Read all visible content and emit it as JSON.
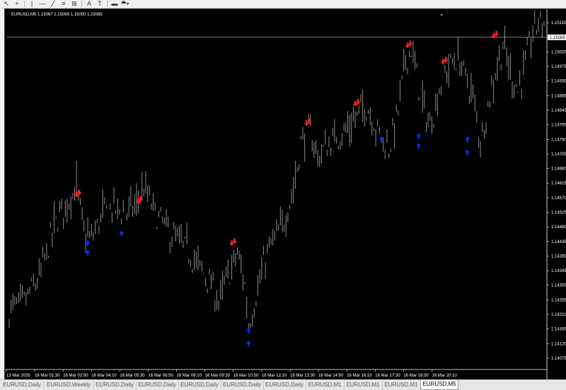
{
  "toolbar": {
    "tools": [
      {
        "name": "cursor-icon",
        "glyph": "↖"
      },
      {
        "name": "crosshair-icon",
        "glyph": "+"
      },
      {
        "name": "vertical-line-icon",
        "glyph": "|"
      },
      {
        "name": "horizontal-line-icon",
        "glyph": "—"
      },
      {
        "name": "trendline-icon",
        "glyph": "╱"
      },
      {
        "name": "channel-icon",
        "glyph": "≡"
      },
      {
        "name": "fibonacci-icon",
        "glyph": "⊞"
      },
      {
        "name": "text-icon",
        "glyph": "A"
      },
      {
        "name": "text-label-icon",
        "glyph": "T"
      },
      {
        "name": "rectangle-icon",
        "glyph": "▬"
      },
      {
        "name": "shapes-menu-icon",
        "glyph": "⯊▾"
      }
    ]
  },
  "chart": {
    "header": "EURUSD,M5  1.15067 1.15069 1.15050 1.15065",
    "current_price_label": "1.15065",
    "colors": {
      "background": "#000000",
      "candle": "#8c8c8c",
      "sell_arrow": "#ff1e1e",
      "buy_arrow": "#1428ff",
      "axis_text": "#ffffff"
    }
  },
  "chart_data": {
    "type": "bar",
    "symbol": "EURUSD",
    "timeframe": "M5",
    "y_ticks": [
      "1.15110",
      "1.15065",
      "1.15020",
      "1.14975",
      "1.14930",
      "1.14885",
      "1.14840",
      "1.14795",
      "1.14750",
      "1.14705",
      "1.14660",
      "1.14615",
      "1.14570",
      "1.14525",
      "1.14480",
      "1.14435",
      "1.14390",
      "1.14345",
      "1.14300",
      "1.14255",
      "1.14210",
      "1.14165",
      "1.14120",
      "1.14075"
    ],
    "ylim": [
      1.1404,
      1.1513
    ],
    "x_ticks": [
      "13 Mar 2026",
      "16 Mar 01:30",
      "16 Mar 02:50",
      "16 Mar 04:10",
      "16 Mar 05:30",
      "16 Mar 06:50",
      "16 Mar 08:10",
      "16 Mar 09:30",
      "16 Mar 10:50",
      "16 Mar 12:10",
      "16 Mar 13:30",
      "16 Mar 14:50",
      "16 Mar 16:10",
      "16 Mar 17:30",
      "16 Mar 18:50",
      "16 Mar 20:10"
    ],
    "price_path": [
      [
        0,
        1.1422
      ],
      [
        8,
        1.1425
      ],
      [
        16,
        1.1432
      ],
      [
        24,
        1.1448
      ],
      [
        30,
        1.1455
      ],
      [
        36,
        1.146
      ],
      [
        40,
        1.1446
      ],
      [
        44,
        1.1444
      ],
      [
        50,
        1.1452
      ],
      [
        56,
        1.1454
      ],
      [
        62,
        1.1452
      ],
      [
        68,
        1.1455
      ],
      [
        72,
        1.146
      ],
      [
        78,
        1.1452
      ],
      [
        86,
        1.1446
      ],
      [
        96,
        1.144
      ],
      [
        106,
        1.1432
      ],
      [
        112,
        1.1425
      ],
      [
        118,
        1.1434
      ],
      [
        122,
        1.144
      ],
      [
        126,
        1.143
      ],
      [
        128,
        1.1418
      ],
      [
        132,
        1.1427
      ],
      [
        138,
        1.144
      ],
      [
        146,
        1.1448
      ],
      [
        152,
        1.146
      ],
      [
        156,
        1.1474
      ],
      [
        160,
        1.1478
      ],
      [
        165,
        1.147
      ],
      [
        172,
        1.1474
      ],
      [
        180,
        1.1478
      ],
      [
        186,
        1.1482
      ],
      [
        190,
        1.1486
      ],
      [
        194,
        1.1482
      ],
      [
        198,
        1.1476
      ],
      [
        203,
        1.1472
      ],
      [
        208,
        1.1484
      ],
      [
        212,
        1.15
      ],
      [
        215,
        1.1503
      ],
      [
        218,
        1.1494
      ],
      [
        222,
        1.1484
      ],
      [
        225,
        1.1479
      ],
      [
        228,
        1.1486
      ],
      [
        232,
        1.1495
      ],
      [
        236,
        1.1498
      ],
      [
        240,
        1.15
      ],
      [
        244,
        1.1494
      ],
      [
        248,
        1.1488
      ],
      [
        252,
        1.1474
      ],
      [
        256,
        1.1486
      ],
      [
        260,
        1.1496
      ],
      [
        264,
        1.1504
      ],
      [
        268,
        1.1496
      ],
      [
        272,
        1.149
      ],
      [
        276,
        1.1498
      ],
      [
        280,
        1.1508
      ],
      [
        283,
        1.1511
      ]
    ],
    "sell_arrows": [
      [
        36,
        1.1458
      ],
      [
        69,
        1.1456
      ],
      [
        119,
        1.1443
      ],
      [
        159,
        1.148
      ],
      [
        185,
        1.1486
      ],
      [
        213,
        1.1504
      ],
      [
        232,
        1.1499
      ],
      [
        259,
        1.1507
      ]
    ],
    "buy_arrows": [
      [
        42,
        1.1443
      ],
      [
        42,
        1.144
      ],
      [
        60,
        1.1446
      ],
      [
        128,
        1.1416
      ],
      [
        128,
        1.1412
      ],
      [
        199,
        1.1475
      ],
      [
        219,
        1.1476
      ],
      [
        219,
        1.1473
      ],
      [
        245,
        1.1475
      ],
      [
        245,
        1.1471
      ]
    ],
    "last_price": 1.15065,
    "grid": false
  },
  "tabs": [
    {
      "label": "EURUSD,Daily",
      "active": false
    },
    {
      "label": "EURUSD,Weekly",
      "active": false
    },
    {
      "label": "EURUSD,Daily",
      "active": false
    },
    {
      "label": "EURUSD,Daily",
      "active": false
    },
    {
      "label": "EURUSD,Daily",
      "active": false
    },
    {
      "label": "EURUSD,Daily",
      "active": false
    },
    {
      "label": "EURUSD,Daily",
      "active": false
    },
    {
      "label": "EURUSD,M1",
      "active": false
    },
    {
      "label": "EURUSD,M1",
      "active": false
    },
    {
      "label": "EURUSD,M1",
      "active": false
    },
    {
      "label": "EURUSD,M5",
      "active": true
    }
  ]
}
